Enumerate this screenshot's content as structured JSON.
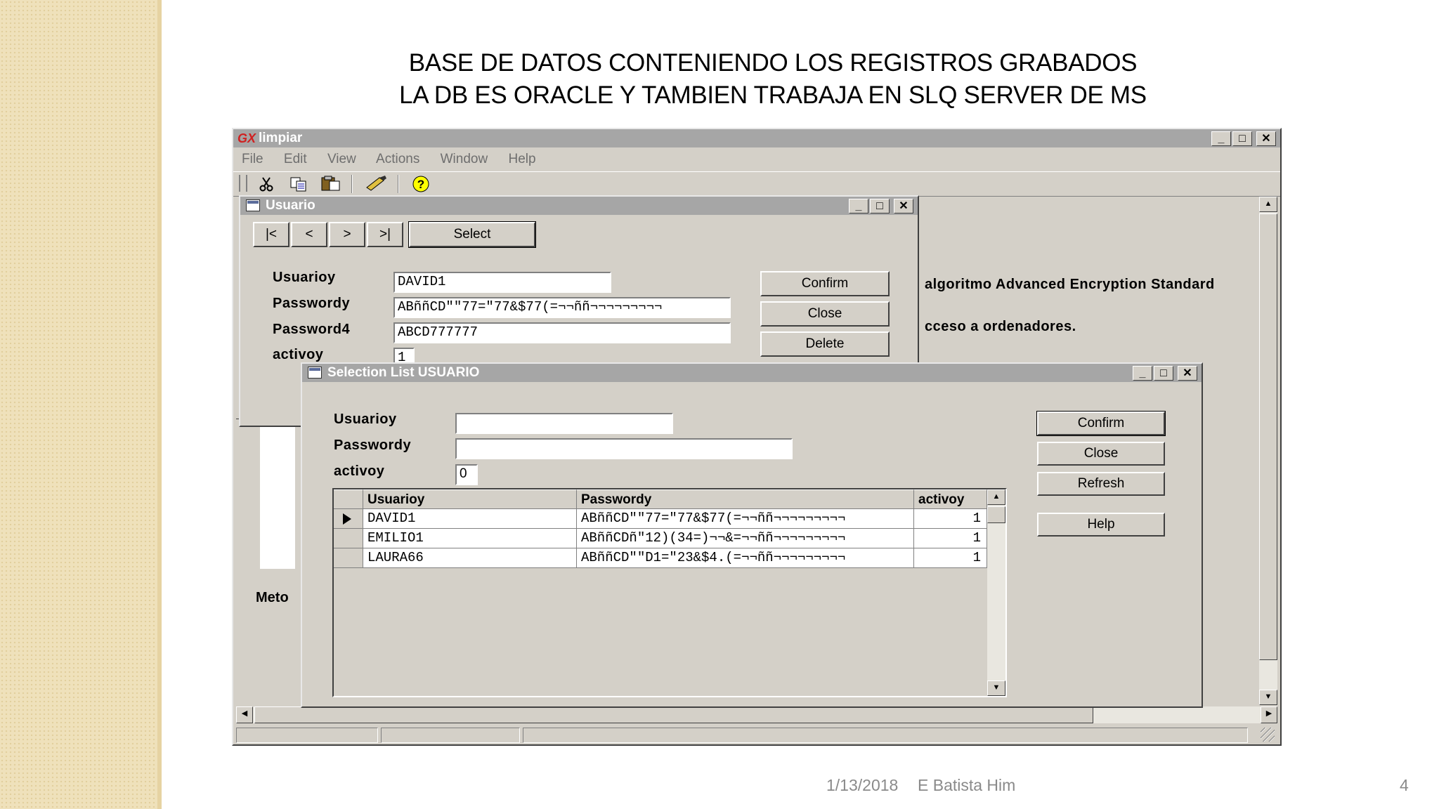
{
  "slide": {
    "title_line1": "BASE DE DATOS CONTENIENDO LOS REGISTROS GRABADOS",
    "title_line2": "LA DB ES ORACLE Y TAMBIEN TRABAJA EN SLQ SERVER DE MS",
    "footer_date": "1/13/2018",
    "footer_author": "E Batista Him",
    "page_number": "4"
  },
  "app": {
    "title_prefix": "GX",
    "title": "limpiar",
    "menu": [
      "File",
      "Edit",
      "View",
      "Actions",
      "Window",
      "Help"
    ],
    "toolbar_icons": [
      "cut-icon",
      "copy-icon",
      "paste-icon",
      "brush-icon",
      "help-icon"
    ],
    "bg_text_1": "algoritmo Advanced Encryption Standard",
    "bg_text_2": "cceso a ordenadores.",
    "left_label": "Meto"
  },
  "usuario": {
    "title": "Usuario",
    "nav": [
      "|<",
      "<",
      ">",
      ">|"
    ],
    "select_label": "Select",
    "labels": [
      "Usuarioy",
      "Passwordy",
      "Password4",
      "activoy"
    ],
    "values": [
      "DAVID1",
      "ABññCD\"\"77=\"77&$77(=¬¬ññ¬¬¬¬¬¬¬¬¬",
      "ABCD777777",
      "1"
    ],
    "buttons": [
      "Confirm",
      "Close",
      "Delete"
    ]
  },
  "selection": {
    "title": "Selection List USUARIO",
    "labels": [
      "Usuarioy",
      "Passwordy",
      "activoy"
    ],
    "values": [
      "",
      "",
      "0"
    ],
    "buttons": [
      "Confirm",
      "Close",
      "Refresh",
      "Help"
    ],
    "columns": [
      "Usuarioy",
      "Passwordy",
      "activoy"
    ],
    "rows": [
      {
        "usuario": "DAVID1",
        "password": "ABññCD\"\"77=\"77&$77(=¬¬ññ¬¬¬¬¬¬¬¬¬",
        "activo": "1"
      },
      {
        "usuario": "EMILIO1",
        "password": "ABññCDñ\"12)(34=)¬¬&=¬¬ññ¬¬¬¬¬¬¬¬¬",
        "activo": "1"
      },
      {
        "usuario": "LAURA66",
        "password": "ABññCD\"\"D1=\"23&$4.(=¬¬ññ¬¬¬¬¬¬¬¬¬",
        "activo": "1"
      }
    ]
  }
}
